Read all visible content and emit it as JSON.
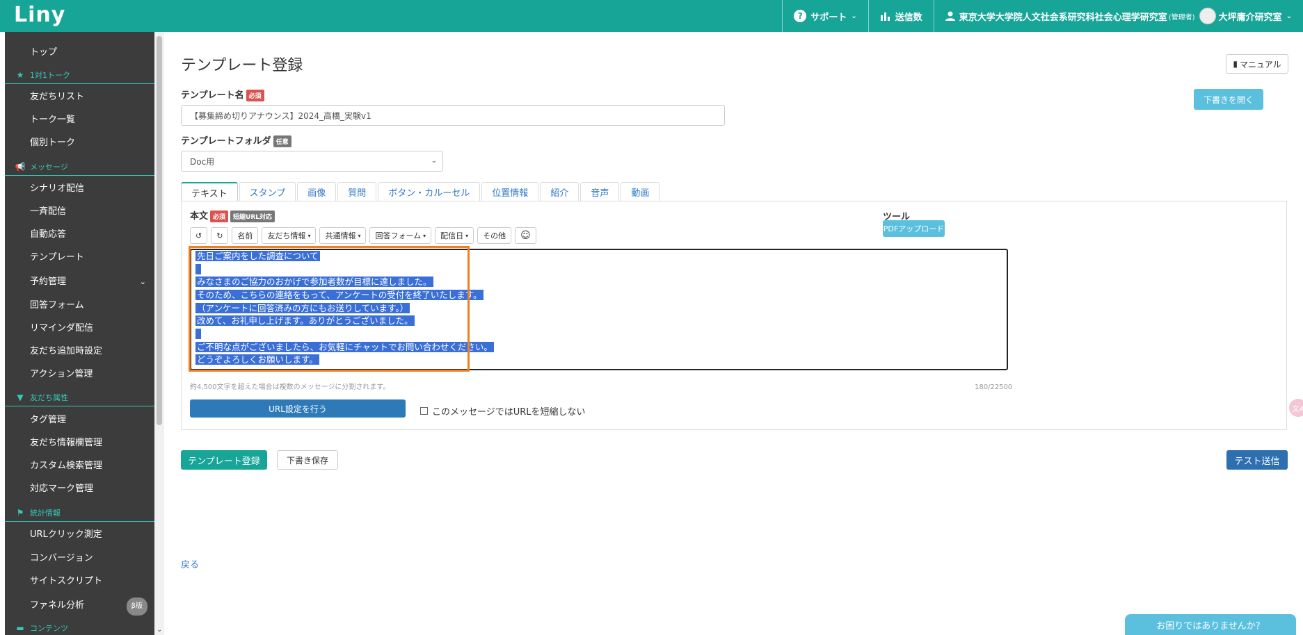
{
  "header": {
    "logo": "Liny",
    "support": "サポート",
    "sends": "送信数",
    "account": "東京大学大学院人文社会系研究科社会心理学研究室",
    "role": "(管理者)",
    "lab": "大坪庸介研究室"
  },
  "sidebar": {
    "top": "トップ",
    "cat_talk": "1対1トーク",
    "friends_list": "友だちリスト",
    "talk_list": "トーク一覧",
    "individual_talk": "個別トーク",
    "cat_message": "メッセージ",
    "scenario": "シナリオ配信",
    "broadcast": "一斉配信",
    "auto_reply": "自動応答",
    "template": "テンプレート",
    "reservation": "予約管理",
    "answer_form": "回答フォーム",
    "reminder": "リマインダ配信",
    "friend_add_setting": "友だち追加時設定",
    "action": "アクション管理",
    "cat_attr": "友だち属性",
    "tag": "タグ管理",
    "friend_info": "友だち情報欄管理",
    "custom_search": "カスタム検索管理",
    "mark": "対応マーク管理",
    "cat_stats": "統計情報",
    "url_click": "URLクリック測定",
    "conversion": "コンバージョン",
    "site_script": "サイトスクリプト",
    "funnel": "ファネル分析",
    "beta": "β版",
    "cat_contents": "コンテンツ"
  },
  "main": {
    "title": "テンプレート登録",
    "manual": "マニュアル",
    "open_draft": "下書きを開く",
    "name_label": "テンプレート名",
    "required": "必須",
    "name_value": "【募集締め切りアナウンス】2024_高橋_実験v1",
    "folder_label": "テンプレートフォルダ",
    "optional": "任意",
    "folder_value": "Doc用",
    "tabs": [
      "テキスト",
      "スタンプ",
      "画像",
      "質問",
      "ボタン・カルーセル",
      "位置情報",
      "紹介",
      "音声",
      "動画"
    ],
    "body_label": "本文",
    "short_url": "短縮URL対応",
    "toolbar": {
      "undo": "↺",
      "redo": "↻",
      "name": "名前",
      "friend_info": "友だち情報",
      "common_info": "共通情報",
      "answer_form": "回答フォーム",
      "send_date": "配信日",
      "other": "その他",
      "emoji": "☺"
    },
    "text_lines": [
      "先日ご案内をした調査について",
      "",
      "みなさまのご協力のおかげで参加者数が目標に達しました。",
      "そのため、こちらの連絡をもって、アンケートの受付を終了いたします。",
      "（アンケートに回答済みの方にもお送りしています。）",
      "改めて、お礼申し上げます。ありがとうございました。",
      "",
      "ご不明な点がございましたら、お気軽にチャットでお問い合わせください。",
      "どうぞよろしくお願いします。"
    ],
    "hint": "約4,500文字を超えた場合は複数のメッセージに分割されます。",
    "counter": "180/22500",
    "url_setting": "URL設定を行う",
    "no_shorten": "このメッセージではURLを短縮しない",
    "tool_label": "ツール",
    "pdf_upload": "PDFアップロード",
    "register": "テンプレート登録",
    "save_draft": "下書き保存",
    "test_send": "テスト送信",
    "back": "戻る",
    "help": "お困りではありませんか？"
  },
  "colors": {
    "brand": "#17a598",
    "sidebar_bg": "#3c3c3c",
    "highlight": "#f07f1f",
    "selection": "#3a6fd8"
  }
}
